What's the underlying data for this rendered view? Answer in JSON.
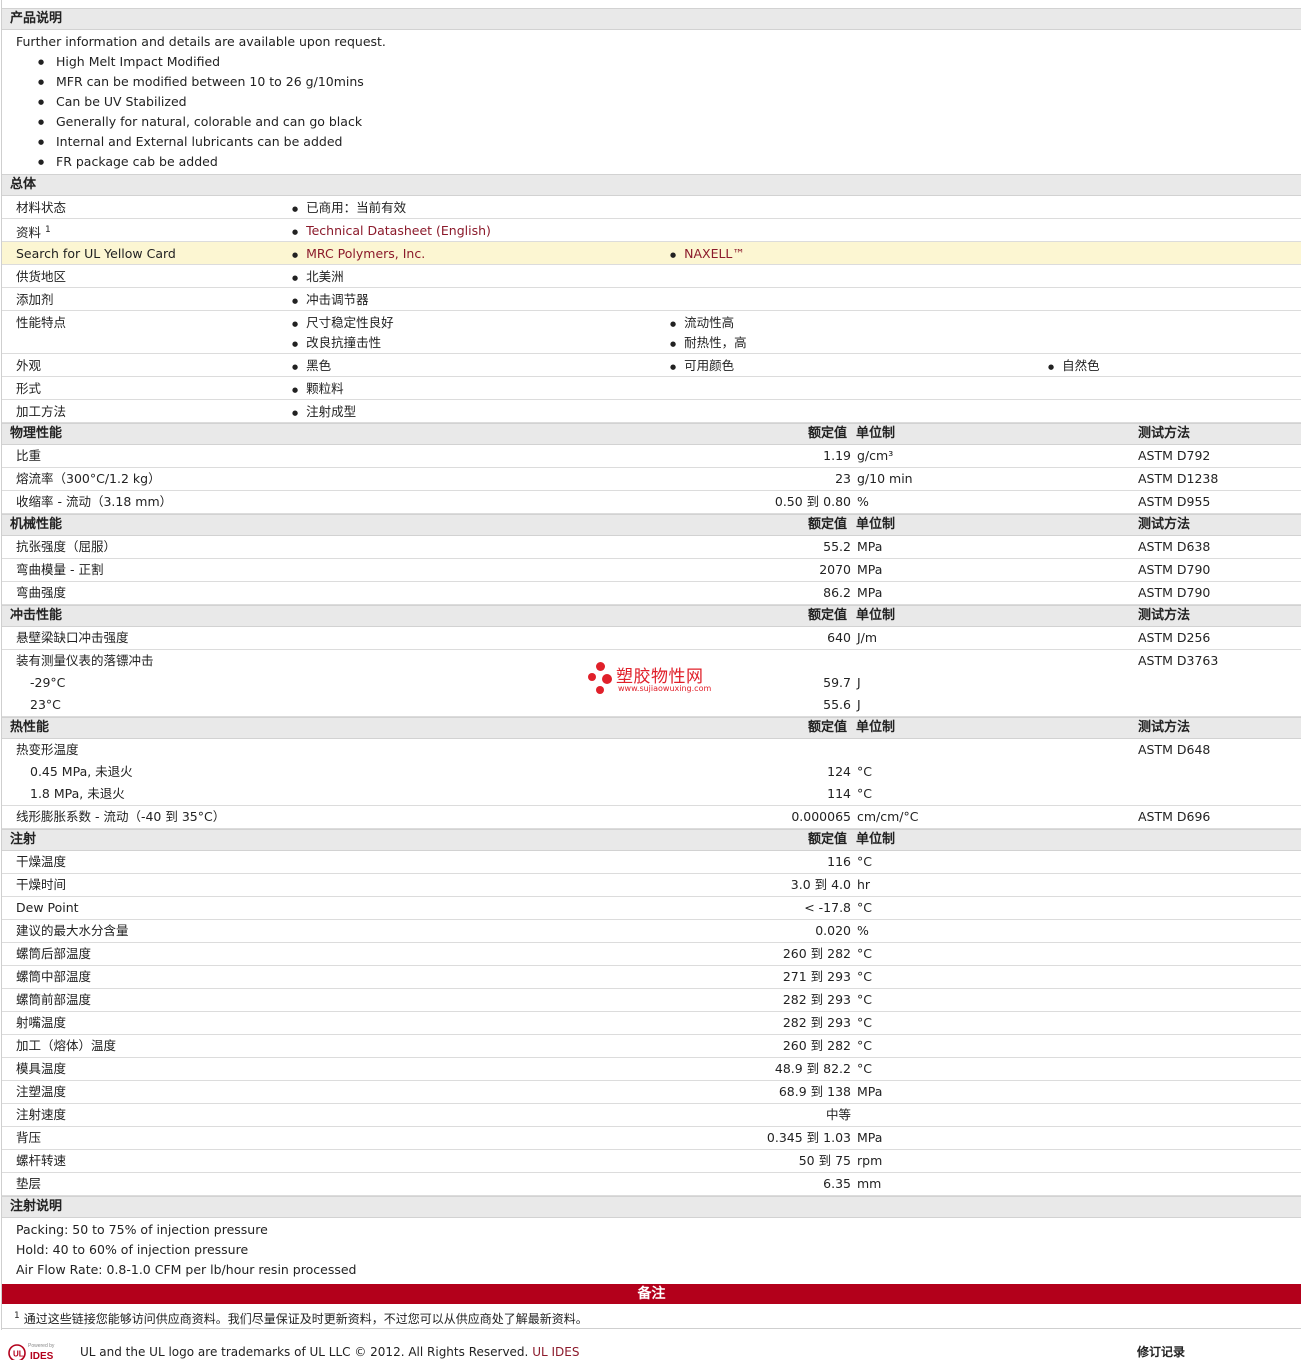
{
  "product_desc": {
    "title": "产品说明",
    "intro": "Further information and details are available upon request.",
    "bullets": [
      "High Melt Impact Modified",
      "MFR can be modified between 10 to 26 g/10mins",
      "Can be UV Stabilized",
      "Generally for natural, colorable and can go black",
      "Internal and External lubricants can be added",
      "FR package cab be added"
    ]
  },
  "general": {
    "title": "总体",
    "rows": [
      {
        "label": "材料状态",
        "sup": "",
        "values": [
          "已商用：当前有效"
        ],
        "link": false,
        "highlight": false
      },
      {
        "label": "资料",
        "sup": "1",
        "values": [
          "Technical Datasheet (English)"
        ],
        "link": true,
        "highlight": false
      },
      {
        "label": "Search for UL Yellow Card",
        "sup": "",
        "values": [
          "MRC Polymers, Inc.",
          "NAXELL™"
        ],
        "link": true,
        "highlight": true
      },
      {
        "label": "供货地区",
        "sup": "",
        "values": [
          "北美洲"
        ],
        "link": false,
        "highlight": false
      },
      {
        "label": "添加剂",
        "sup": "",
        "values": [
          "冲击调节器"
        ],
        "link": false,
        "highlight": false
      },
      {
        "label": "性能特点",
        "sup": "",
        "values": [
          "尺寸稳定性良好",
          "流动性高",
          "改良抗撞击性",
          "耐热性，高"
        ],
        "link": false,
        "highlight": false,
        "two_line": true
      },
      {
        "label": "外观",
        "sup": "",
        "values": [
          "黑色",
          "可用颜色",
          "自然色"
        ],
        "link": false,
        "highlight": false
      },
      {
        "label": "形式",
        "sup": "",
        "values": [
          "颗粒料"
        ],
        "link": false,
        "highlight": false
      },
      {
        "label": "加工方法",
        "sup": "",
        "values": [
          "注射成型"
        ],
        "link": false,
        "highlight": false
      }
    ]
  },
  "headers": {
    "nominal": "额定值",
    "unit": "单位制",
    "method": "测试方法"
  },
  "physical": {
    "title": "物理性能",
    "rows": [
      {
        "label": "比重",
        "value": "1.19",
        "unit": "g/cm³",
        "method": "ASTM D792"
      },
      {
        "label": "熔流率（300°C/1.2 kg）",
        "value": "23",
        "unit": "g/10 min",
        "method": "ASTM D1238"
      },
      {
        "label": "收缩率 - 流动（3.18 mm）",
        "value": "0.50 到  0.80",
        "unit": "%",
        "method": "ASTM D955"
      }
    ]
  },
  "mechanical": {
    "title": "机械性能",
    "rows": [
      {
        "label": "抗张强度（屈服）",
        "value": "55.2",
        "unit": "MPa",
        "method": "ASTM D638"
      },
      {
        "label": "弯曲模量 - 正割",
        "value": "2070",
        "unit": "MPa",
        "method": "ASTM D790"
      },
      {
        "label": "弯曲强度",
        "value": "86.2",
        "unit": "MPa",
        "method": "ASTM D790"
      }
    ]
  },
  "impact": {
    "title": "冲击性能",
    "rows": [
      {
        "label": "悬壁梁缺口冲击强度",
        "value": "640",
        "unit": "J/m",
        "method": "ASTM D256",
        "indent": false
      },
      {
        "label": "装有测量仪表的落镖冲击",
        "value": "",
        "unit": "",
        "method": "ASTM D3763",
        "indent": false,
        "nob": true
      },
      {
        "label": "-29°C",
        "value": "59.7",
        "unit": "J",
        "method": "",
        "indent": true,
        "nob": true
      },
      {
        "label": "23°C",
        "value": "55.6",
        "unit": "J",
        "method": "",
        "indent": true
      }
    ]
  },
  "thermal": {
    "title": "热性能",
    "rows": [
      {
        "label": "热变形温度",
        "value": "",
        "unit": "",
        "method": "ASTM D648",
        "indent": false,
        "nob": true
      },
      {
        "label": "0.45 MPa, 未退火",
        "value": "124",
        "unit": "°C",
        "method": "",
        "indent": true,
        "nob": true
      },
      {
        "label": "1.8 MPa, 未退火",
        "value": "114",
        "unit": "°C",
        "method": "",
        "indent": true
      },
      {
        "label": "线形膨胀系数 - 流动（-40 到  35°C）",
        "value": "0.000065",
        "unit": "cm/cm/°C",
        "method": "ASTM D696",
        "indent": false
      }
    ]
  },
  "injection": {
    "title": "注射",
    "rows": [
      {
        "label": "干燥温度",
        "value": "116",
        "unit": "°C"
      },
      {
        "label": "干燥时间",
        "value": "3.0 到  4.0",
        "unit": "hr"
      },
      {
        "label": "Dew Point",
        "value": "< -17.8",
        "unit": "°C"
      },
      {
        "label": "建议的最大水分含量",
        "value": "0.020",
        "unit": "%"
      },
      {
        "label": "螺筒后部温度",
        "value": "260 到  282",
        "unit": "°C"
      },
      {
        "label": "螺筒中部温度",
        "value": "271 到  293",
        "unit": "°C"
      },
      {
        "label": "螺筒前部温度",
        "value": "282 到  293",
        "unit": "°C"
      },
      {
        "label": "射嘴温度",
        "value": "282 到  293",
        "unit": "°C"
      },
      {
        "label": "加工（熔体）温度",
        "value": "260 到  282",
        "unit": "°C"
      },
      {
        "label": "模具温度",
        "value": "48.9 到  82.2",
        "unit": "°C"
      },
      {
        "label": "注塑温度",
        "value": "68.9 到  138",
        "unit": "MPa"
      },
      {
        "label": "注射速度",
        "value": "中等",
        "unit": ""
      },
      {
        "label": "背压",
        "value": "0.345 到  1.03",
        "unit": "MPa"
      },
      {
        "label": "螺杆转速",
        "value": "50 到  75",
        "unit": "rpm"
      },
      {
        "label": "垫层",
        "value": "6.35",
        "unit": "mm"
      }
    ]
  },
  "injection_notes": {
    "title": "注射说明",
    "lines": [
      "Packing: 50 to 75% of injection pressure",
      "Hold: 40 to 60% of injection pressure",
      "Air Flow Rate: 0.8-1.0 CFM per lb/hour resin processed"
    ]
  },
  "remarks": {
    "title": "备注",
    "footnote_num": "1",
    "footnote": "通过这些链接您能够访问供应商资料。我们尽量保证及时更新资料，不过您可以从供应商处了解最新资料。"
  },
  "footer": {
    "copyright": "UL and the UL logo are trademarks of UL LLC © 2012. All Rights Reserved.",
    "link": "UL IDES",
    "revision": "修订记录",
    "logo_text": "IDES"
  },
  "watermark": {
    "text": "塑胶物性网",
    "url": "www.sujiaowuxing.com"
  },
  "colors": {
    "accent_red": "#b3001b",
    "link": "#8b1a2b",
    "highlight": "#fcf6d2",
    "section_bg": "#e9e9e9"
  }
}
